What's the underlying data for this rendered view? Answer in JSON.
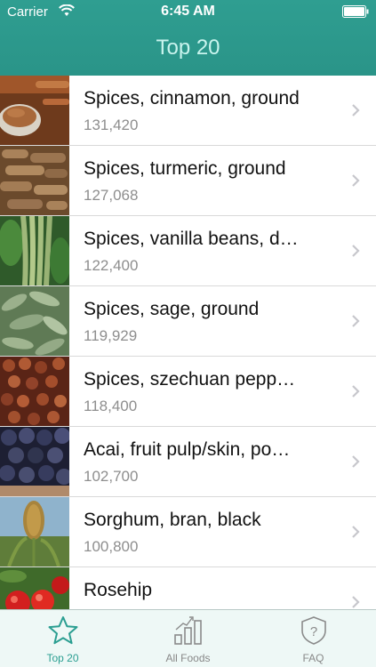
{
  "status_bar": {
    "carrier": "Carrier",
    "time": "6:45 AM"
  },
  "nav": {
    "title": "Top 20"
  },
  "foods": [
    {
      "name": "Spices, cinnamon, ground",
      "value": "131,420",
      "image": "cinnamon"
    },
    {
      "name": "Spices, turmeric, ground",
      "value": "127,068",
      "image": "turmeric"
    },
    {
      "name": "Spices, vanilla beans, d…",
      "value": "122,400",
      "image": "vanilla"
    },
    {
      "name": "Spices, sage, ground",
      "value": "119,929",
      "image": "sage"
    },
    {
      "name": "Spices, szechuan pepp…",
      "value": "118,400",
      "image": "szechuan-pepper"
    },
    {
      "name": "Acai, fruit pulp/skin, po…",
      "value": "102,700",
      "image": "acai"
    },
    {
      "name": "Sorghum, bran, black",
      "value": "100,800",
      "image": "sorghum"
    },
    {
      "name": "Rosehip",
      "value": "",
      "image": "rosehip"
    }
  ],
  "tabs": [
    {
      "label": "Top 20",
      "icon": "star-icon",
      "active": true
    },
    {
      "label": "All Foods",
      "icon": "bar-chart-icon",
      "active": false
    },
    {
      "label": "FAQ",
      "icon": "shield-question-icon",
      "active": false
    }
  ],
  "colors": {
    "header": "#2a9488",
    "title": "#c9f4ee",
    "accent": "#2a9e91"
  }
}
